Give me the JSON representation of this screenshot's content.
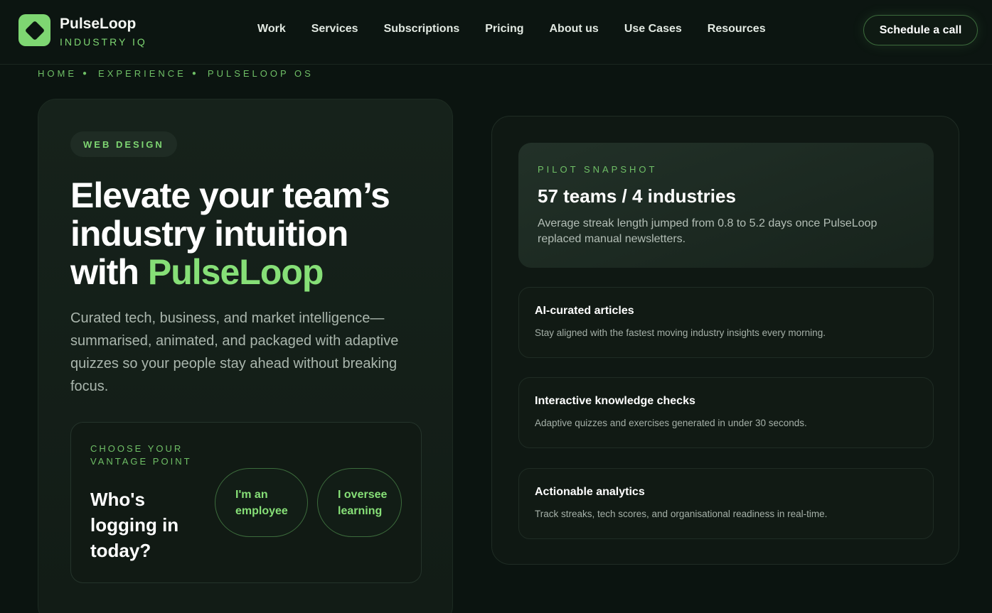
{
  "header": {
    "brand_name": "PulseLoop",
    "brand_sub": "INDUSTRY IQ",
    "nav": [
      "Work",
      "Services",
      "Subscriptions",
      "Pricing",
      "About us",
      "Use Cases",
      "Resources"
    ],
    "cta_label": "Schedule a call"
  },
  "breadcrumb": [
    "HOME",
    "EXPERIENCE",
    "PULSELOOP OS"
  ],
  "hero": {
    "pill": "WEB DESIGN",
    "headline_line1": "Elevate your team’s",
    "headline_line2": "industry intuition",
    "headline_line3_prefix": "with ",
    "headline_accent": "PulseLoop",
    "lede": "Curated tech, business, and market intelligence—summarised, animated, and packaged with adaptive quizzes so your people stay ahead without breaking focus.",
    "vantage": {
      "eyebrow": "CHOOSE YOUR VANTAGE POINT",
      "question": "Who's logging in today?",
      "choice_employee": "I'm an employee",
      "choice_oversee": "I oversee learning"
    }
  },
  "snapshot": {
    "eyebrow": "PILOT SNAPSHOT",
    "title": "57 teams / 4 industries",
    "body": "Average streak length jumped from 0.8 to 5.2 days once PulseLoop replaced manual newsletters."
  },
  "features": [
    {
      "title": "AI-curated articles",
      "body": "Stay aligned with the fastest moving industry insights every morning."
    },
    {
      "title": "Interactive knowledge checks",
      "body": "Adaptive quizzes and exercises generated in under 30 seconds."
    },
    {
      "title": "Actionable analytics",
      "body": "Track streaks, tech scores, and organisational readiness in real-time."
    }
  ],
  "colors": {
    "background": "#0b1410",
    "accent": "#7ed672",
    "text": "#ffffff"
  },
  "icons": {
    "logo": "diamond-icon"
  }
}
